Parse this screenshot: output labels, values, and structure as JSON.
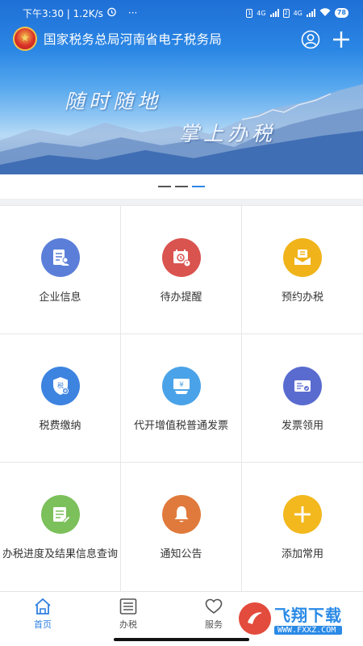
{
  "status_bar": {
    "time_speed": "下午3:30 | 1.2K/s",
    "more": "···",
    "network_1": "4G",
    "network_2": "4G",
    "battery": "78"
  },
  "header": {
    "title": "国家税务总局河南省电子税务局",
    "icons": [
      "emblem-icon",
      "user-icon",
      "plus-icon"
    ]
  },
  "banner": {
    "line1": "随时随地",
    "line2": "掌上办税",
    "page_count": 3,
    "active_page": 3
  },
  "grid": {
    "items": [
      {
        "label": "企业信息",
        "icon": "company-info-icon",
        "color": "#5b7fd9"
      },
      {
        "label": "待办提醒",
        "icon": "todo-reminder-icon",
        "color": "#d9534f"
      },
      {
        "label": "预约办税",
        "icon": "appointment-icon",
        "color": "#f0b31a"
      },
      {
        "label": "税费缴纳",
        "icon": "tax-payment-icon",
        "color": "#3d83e0"
      },
      {
        "label": "代开增值税普通发票",
        "icon": "invoice-issue-icon",
        "color": "#4aa3e8"
      },
      {
        "label": "发票领用",
        "icon": "invoice-receive-icon",
        "color": "#5a6bd0"
      },
      {
        "label": "办税进度及结果信息查询",
        "icon": "progress-query-icon",
        "color": "#7bc05a"
      },
      {
        "label": "通知公告",
        "icon": "notice-icon",
        "color": "#e07a3c"
      },
      {
        "label": "添加常用",
        "icon": "add-common-icon",
        "color": "#f2b81d"
      }
    ]
  },
  "tabbar": {
    "tabs": [
      {
        "label": "首页",
        "icon": "home-icon",
        "active": true
      },
      {
        "label": "办税",
        "icon": "tax-list-icon",
        "active": false
      },
      {
        "label": "服务",
        "icon": "service-icon",
        "active": false
      }
    ]
  },
  "watermark": {
    "name": "飞翔下载",
    "url": "WWW.FXXZ.COM"
  },
  "colors": {
    "accent": "#2f7fe0",
    "header_top": "#1f6fd6"
  }
}
